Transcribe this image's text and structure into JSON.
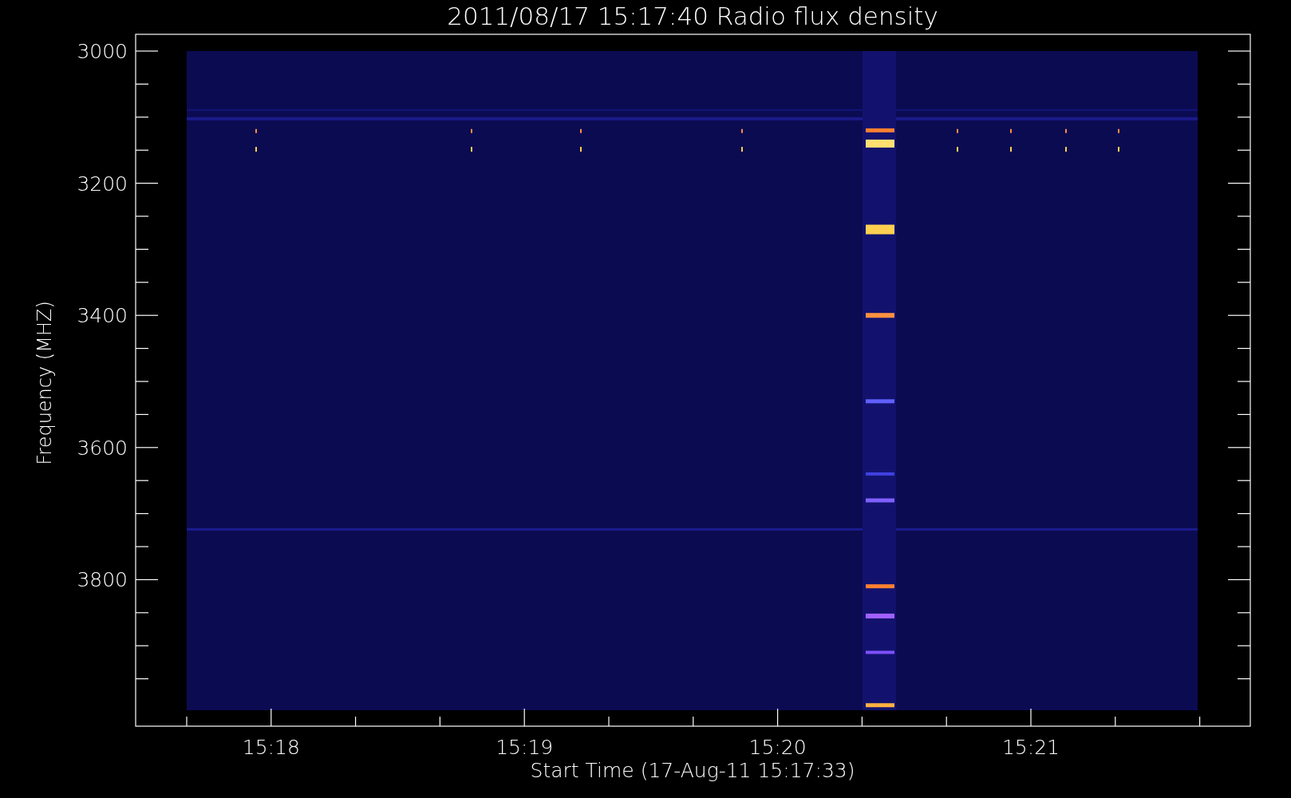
{
  "title": "2011/08/17 15:17:40 Radio flux density",
  "y_axis": {
    "label": "Frequency (MHZ)",
    "ticks": [
      "3000",
      "3200",
      "3400",
      "3600",
      "3800"
    ]
  },
  "x_axis": {
    "label": "Start Time (17-Aug-11 15:17:33)",
    "ticks": [
      "15:18",
      "15:19",
      "15:20",
      "15:21"
    ]
  }
}
